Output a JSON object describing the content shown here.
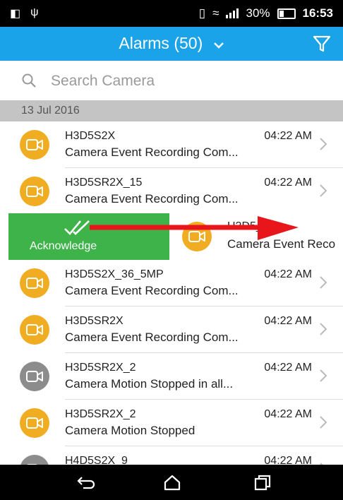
{
  "status_bar": {
    "battery": "30%",
    "time": "16:53"
  },
  "header": {
    "title": "Alarms (50)"
  },
  "search": {
    "placeholder": "Search Camera"
  },
  "list": {
    "date": "13 Jul 2016",
    "swipe_action_label": "Acknowledge",
    "rows": [
      {
        "name": "H3D5S2X",
        "time": "04:22 AM",
        "desc": "Camera Event Recording Com...",
        "icon_color": "#f0ad22"
      },
      {
        "name": "H3D5SR2X_15",
        "time": "04:22 AM",
        "desc": "Camera Event Recording Com...",
        "icon_color": "#f0ad22"
      },
      {
        "name": "H3D5_14",
        "time": "",
        "desc": "Camera Event Reco",
        "icon_color": "#f0ad22"
      },
      {
        "name": "H3D5S2X_36_5MP",
        "time": "04:22 AM",
        "desc": "Camera Event Recording Com...",
        "icon_color": "#f0ad22"
      },
      {
        "name": "H3D5SR2X",
        "time": "04:22 AM",
        "desc": "Camera Event Recording Com...",
        "icon_color": "#f0ad22"
      },
      {
        "name": "H3D5SR2X_2",
        "time": "04:22 AM",
        "desc": "Camera Motion Stopped in all...",
        "icon_color": "#8c8c8c"
      },
      {
        "name": "H3D5SR2X_2",
        "time": "04:22 AM",
        "desc": "Camera Motion Stopped",
        "icon_color": "#f0ad22"
      },
      {
        "name": "H4D5S2X_9",
        "time": "04:22 AM",
        "desc": "",
        "icon_color": "#8c8c8c"
      }
    ]
  },
  "colors": {
    "header_bg": "#1aa3e8",
    "acknowledge_bg": "#3db34a",
    "date_header_bg": "#c4c4c4",
    "annotation_arrow": "#e8161b"
  }
}
